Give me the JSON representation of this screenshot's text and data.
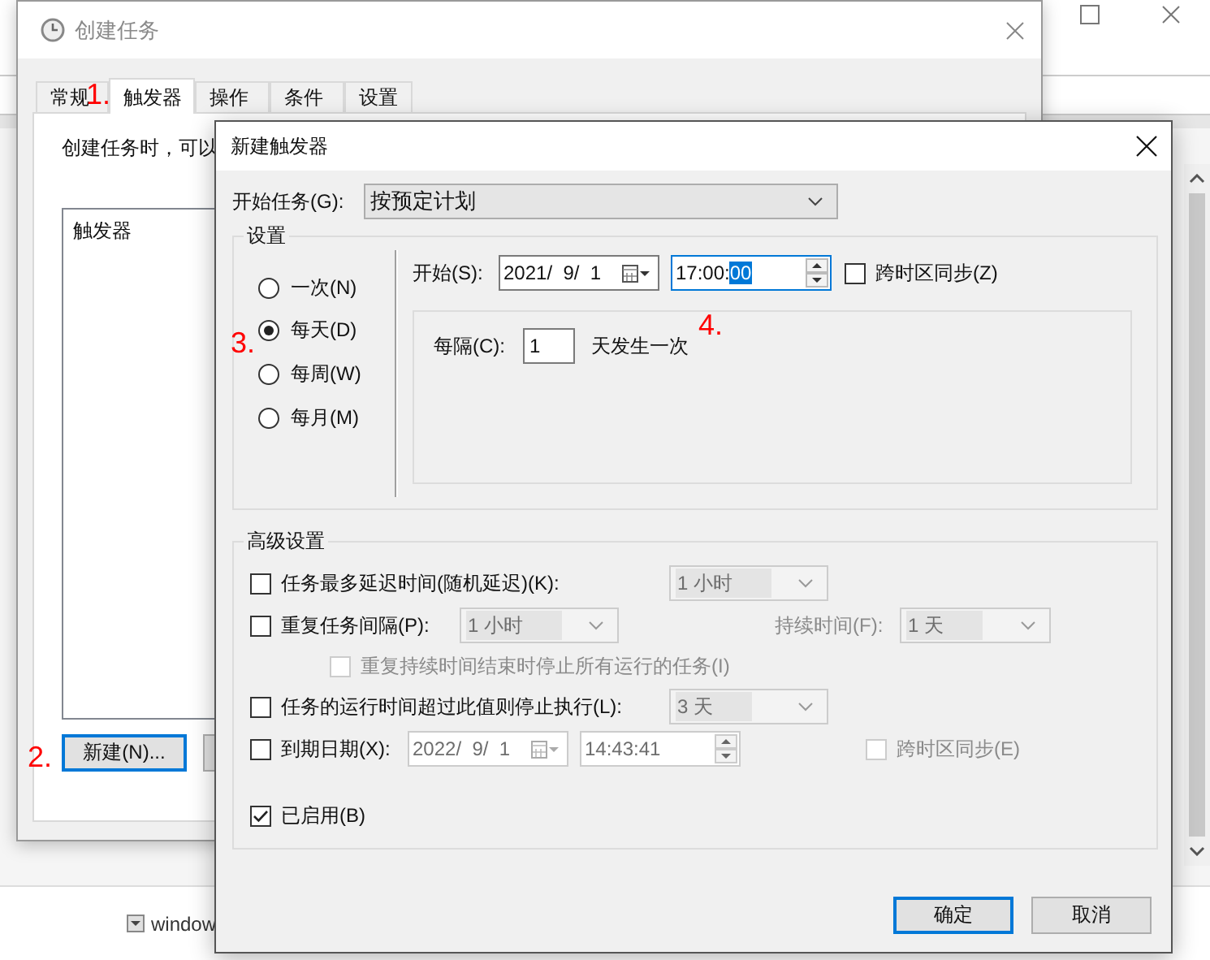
{
  "background_window": {
    "list_item": "window"
  },
  "task_dialog": {
    "title": "创建任务",
    "tab_marker": "1.",
    "tabs": [
      {
        "label": "常规",
        "selected": false
      },
      {
        "label": "触发器",
        "selected": true
      },
      {
        "label": "操作",
        "selected": false
      },
      {
        "label": "条件",
        "selected": false
      },
      {
        "label": "设置",
        "selected": false
      }
    ],
    "description": "创建任务时，可以",
    "list_header": "触发器",
    "new_button": "新建(N)...",
    "button_marker": "2."
  },
  "trigger_dialog": {
    "title": "新建触发器",
    "start_task_label": "开始任务(G):",
    "start_task_value": "按预定计划",
    "settings": {
      "title": "设置",
      "schedule_marker": "3.",
      "schedules": [
        {
          "label": "一次(N)",
          "selected": false
        },
        {
          "label": "每天(D)",
          "selected": true
        },
        {
          "label": "每周(W)",
          "selected": false
        },
        {
          "label": "每月(M)",
          "selected": false
        }
      ],
      "start_label": "开始(S):",
      "start_date": "2021/  9/  1",
      "start_time": "17:00:",
      "start_time_highlighted": "00",
      "time_marker": "4.",
      "sync_checked": false,
      "sync_label": "跨时区同步(Z)",
      "every_label": "每隔(C):",
      "every_value": "1",
      "every_unit": "天发生一次"
    },
    "advanced": {
      "title": "高级设置",
      "delay": {
        "checked": false,
        "label": "任务最多延迟时间(随机延迟)(K):",
        "value": "1 小时"
      },
      "repeat": {
        "checked": false,
        "label": "重复任务间隔(P):",
        "value": "1 小时",
        "duration_label": "持续时间(F):",
        "duration_value": "1 天"
      },
      "stop_at_end": {
        "checked": false,
        "disabled": true,
        "label": "重复持续时间结束时停止所有运行的任务(I)"
      },
      "timeout": {
        "checked": false,
        "label": "任务的运行时间超过此值则停止执行(L):",
        "value": "3 天"
      },
      "expire": {
        "checked": false,
        "label": "到期日期(X):",
        "date": "2022/  9/  1",
        "time": "14:43:41",
        "sync_checked": false,
        "sync_label": "跨时区同步(E)"
      },
      "enabled": {
        "checked": true,
        "label": "已启用(B)"
      }
    },
    "ok_button": "确定",
    "cancel_button": "取消"
  }
}
